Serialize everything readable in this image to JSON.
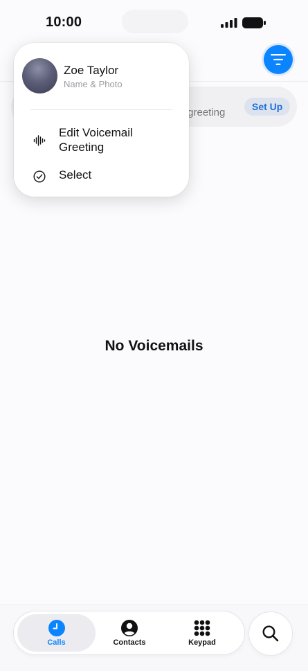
{
  "status_bar": {
    "time": "10:00",
    "signal_icon": "cellular-signal-icon",
    "battery_icon": "battery-icon"
  },
  "header": {
    "filter_icon": "filter-lines-icon"
  },
  "banner": {
    "partial_text": "r greeting",
    "setup_label": "Set Up"
  },
  "menu": {
    "profile": {
      "name": "Zoe Taylor",
      "subtitle": "Name & Photo"
    },
    "items": [
      {
        "label": "Edit Voicemail Greeting",
        "icon": "waveform-icon"
      },
      {
        "label": "Select",
        "icon": "checkmark-circle-icon"
      }
    ]
  },
  "main": {
    "empty_title": "No Voicemails"
  },
  "tab_bar": {
    "tabs": [
      {
        "label": "Calls",
        "icon": "clock-icon",
        "active": true
      },
      {
        "label": "Contacts",
        "icon": "person-circle-icon",
        "active": false
      },
      {
        "label": "Keypad",
        "icon": "keypad-icon",
        "active": false
      }
    ],
    "search_icon": "magnifying-glass-icon"
  },
  "colors": {
    "accent": "#0a84ff",
    "background": "#fbfbfd"
  }
}
